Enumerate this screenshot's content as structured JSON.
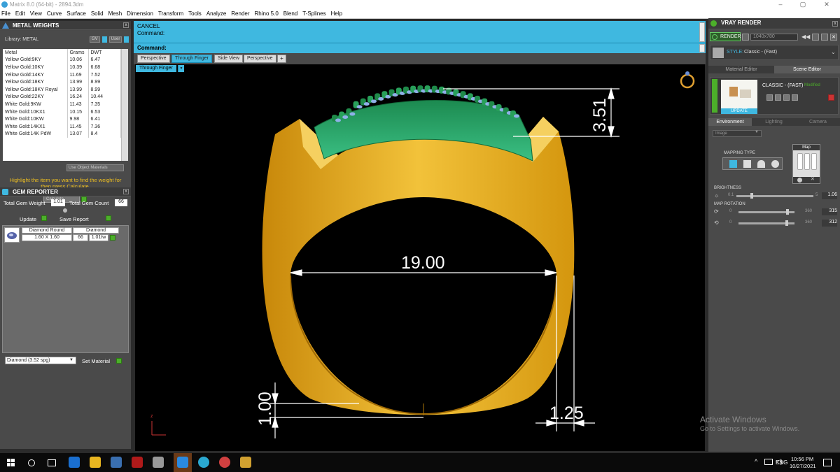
{
  "window": {
    "title": "Matrix 8.0 (64-bit) - 2894.3dm",
    "minimize": "–",
    "maximize": "▢",
    "close": "✕"
  },
  "menu": [
    "File",
    "Edit",
    "View",
    "Curve",
    "Surface",
    "Solid",
    "Mesh",
    "Dimension",
    "Transform",
    "Tools",
    "Analyze",
    "Render",
    "Rhino 5.0",
    "Blend",
    "T-Splines",
    "Help"
  ],
  "metal_weights": {
    "title": "METAL WEIGHTS",
    "library_label": "Library: METAL",
    "gv_label": "GV",
    "user_label": "User",
    "columns": [
      "Metal",
      "Grams",
      "DWT"
    ],
    "rows": [
      [
        "Yellow Gold:9KY",
        "10.06",
        "6.47"
      ],
      [
        "Yellow Gold:10KY",
        "10.39",
        "6.68"
      ],
      [
        "Yellow Gold:14KY",
        "11.69",
        "7.52"
      ],
      [
        "Yellow Gold:18KY",
        "13.99",
        "8.99"
      ],
      [
        "Yellow Gold:18KY Royal",
        "13.99",
        "8.99"
      ],
      [
        "Yellow Gold:22KY",
        "16.24",
        "10.44"
      ],
      [
        "White Gold:9KW",
        "11.43",
        "7.35"
      ],
      [
        "White Gold:10KX1",
        "10.15",
        "6.53"
      ],
      [
        "White Gold:10KW",
        "9.98",
        "6.41"
      ],
      [
        "White Gold:14KX1",
        "11.45",
        "7.36"
      ],
      [
        "White Gold:14K PdW",
        "13.07",
        "8.4"
      ]
    ],
    "use_object_materials": "Use Object Materials",
    "hint": "Highlight the item you want to find the weight for then press Calculate.",
    "calculate": "Calculate"
  },
  "gem_reporter": {
    "title": "GEM REPORTER",
    "total_gem_weight_label": "Total Gem Weight",
    "total_gem_weight": "1.01",
    "total_gem_count_label": "Total Gem Count",
    "total_gem_count": "66",
    "update": "Update",
    "save_report": "Save Report",
    "gem": {
      "shape": "Diamond Round",
      "type": "Diamond",
      "size": "1.60 X 1.60",
      "count": "66",
      "weight": "1.01tw"
    },
    "material_select": "Diamond    (3.52 spg)",
    "set_material": "Set Material"
  },
  "command": {
    "line1": "CANCEL",
    "line2": "Command:",
    "prompt": "Command:"
  },
  "viewport_tabs": [
    "Perspective",
    "Through Finger",
    "Side View",
    "Perspective",
    "+"
  ],
  "active_tab": 1,
  "viewport_label": "Through Finger",
  "dimensions": {
    "inner_diameter": "19.00",
    "top_height": "3.51",
    "bottom_thickness": "1.00",
    "side_width": "1.25"
  },
  "axis_label": "z",
  "activate_windows": {
    "title": "Activate Windows",
    "subtitle": "Go to Settings to activate Windows."
  },
  "vray": {
    "title": "VRAY RENDER",
    "render_btn": "RENDER",
    "resolution": "1040x780",
    "style_label": "STYLE:",
    "style_value": "Classic - (Fast)",
    "tabs": [
      "Material Editor",
      "Scene Editor"
    ],
    "preset_name": "CLASSIC - (FAST)",
    "preset_state": "Modified",
    "update": "UPDATE",
    "env_tabs": [
      "Environment",
      "Lighting",
      "Camera"
    ],
    "env_select": "Image",
    "mapping_type": "MAPPING TYPE",
    "map_label": "Map",
    "brightness_label": "BRIGHTNESS",
    "brightness_min": "0.1",
    "brightness_max": "5",
    "brightness_value": "1.06",
    "map_rotation_label": "MAP ROTATION",
    "rot1_min": "0",
    "rot1_max": "360",
    "rot1_value": "315",
    "rot2_min": "0",
    "rot2_max": "360",
    "rot2_value": "312"
  },
  "taskbar": {
    "lang": "ENG",
    "time": "10:56 PM",
    "date": "10/27/2021"
  },
  "colors": {
    "gold": "#e8b21c",
    "green": "#2aa866",
    "command_bg": "#3fb8e0",
    "accent_green": "#4caf2a"
  }
}
